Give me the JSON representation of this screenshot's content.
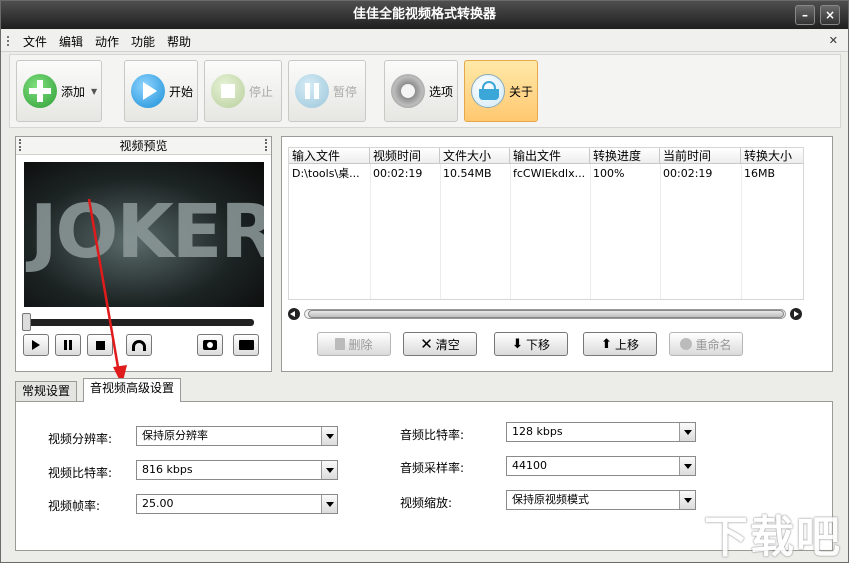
{
  "window": {
    "title": "佳佳全能视频格式转换器"
  },
  "menu": [
    "文件",
    "编辑",
    "动作",
    "功能",
    "帮助"
  ],
  "toolbar": {
    "add": "添加",
    "start": "开始",
    "stop": "停止",
    "pause": "暂停",
    "options": "选项",
    "about": "关于"
  },
  "preview": {
    "title": "视频预览",
    "video_text": "JOKER",
    "position": 0
  },
  "table": {
    "headers": [
      "输入文件",
      "视频时间",
      "文件大小",
      "输出文件",
      "转换进度",
      "当前时间",
      "转换大小"
    ],
    "rows": [
      [
        "D:\\tools\\桌...",
        "00:02:19",
        "10.54MB",
        "fcCWIEkdlx...",
        "100%",
        "00:02:19",
        "16MB"
      ]
    ]
  },
  "actions": {
    "delete": "删除",
    "clear": "清空",
    "move_down": "下移",
    "move_up": "上移",
    "rename": "重命名"
  },
  "tabs": [
    "常规设置",
    "音视频高级设置"
  ],
  "settings": {
    "video_resolution": {
      "label": "视频分辨率:",
      "value": "保持原分辨率"
    },
    "video_bitrate": {
      "label": "视频比特率:",
      "value": "816 kbps"
    },
    "video_fps": {
      "label": "视频帧率:",
      "value": "25.00"
    },
    "audio_bitrate": {
      "label": "音频比特率:",
      "value": "128 kbps"
    },
    "audio_samplerate": {
      "label": "音频采样率:",
      "value": "44100"
    },
    "video_scale": {
      "label": "视频缩放:",
      "value": "保持原视频模式"
    }
  },
  "watermark": "下载吧",
  "colors": {
    "accent": "#1a8fd6",
    "add_green": "#3cb043",
    "active_button": "#ffc870",
    "annotation_arrow": "#e01b1b"
  }
}
